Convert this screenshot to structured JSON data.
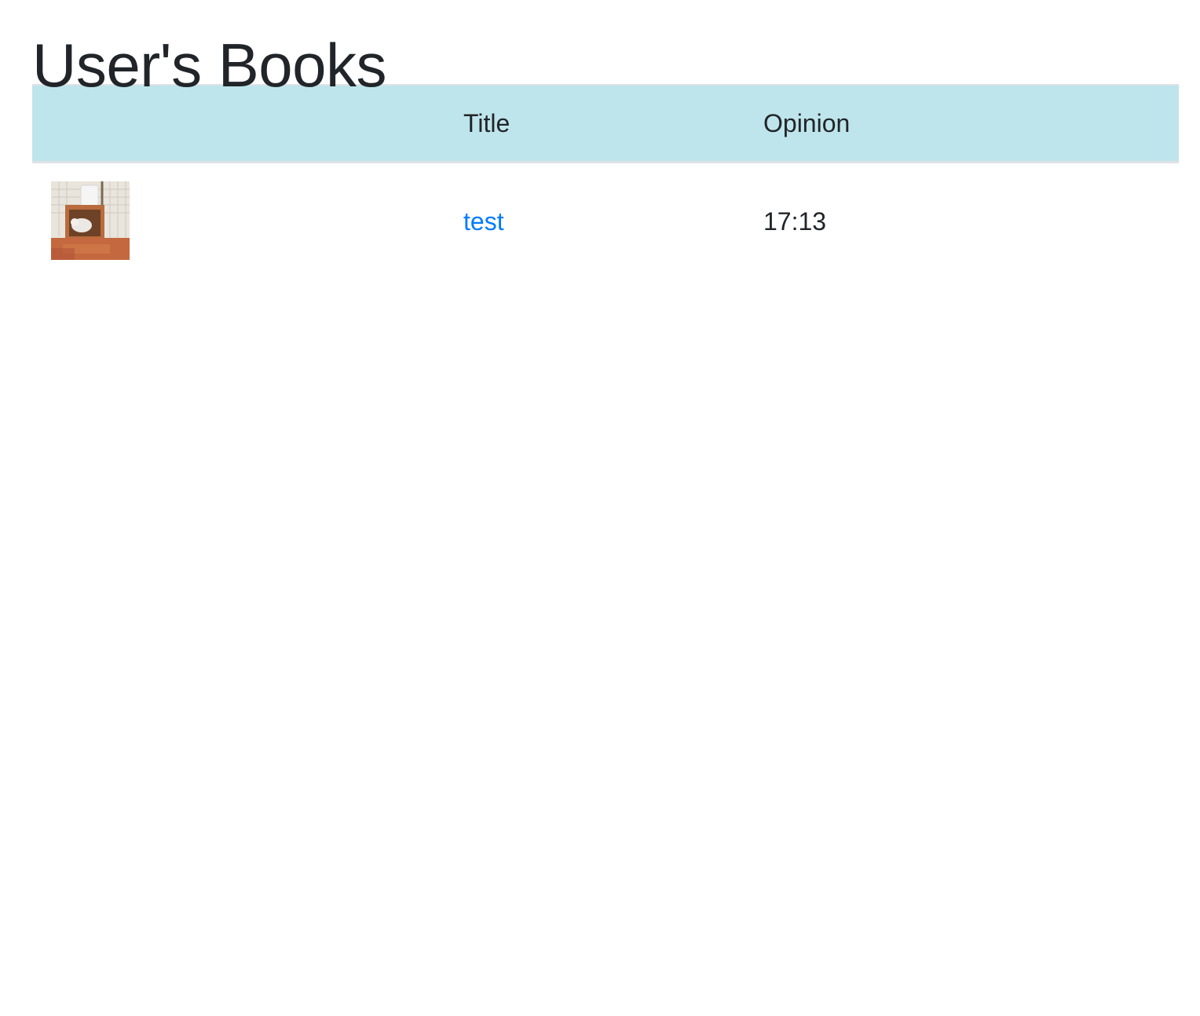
{
  "page": {
    "title": "User's Books"
  },
  "table": {
    "headers": {
      "cover": "",
      "title": "Title",
      "opinion": "Opinion"
    },
    "rows": [
      {
        "title": "test",
        "opinion": "17:13",
        "cover_alt": "book cover thumbnail"
      }
    ]
  },
  "colors": {
    "header_bg": "#bee5eb",
    "link": "#007bff",
    "text": "#212529"
  }
}
